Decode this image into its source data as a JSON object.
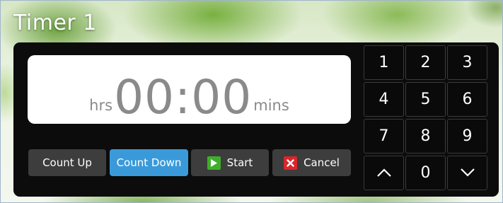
{
  "window": {
    "title": "Timer 1"
  },
  "display": {
    "time": "00:00",
    "hours_unit": "hrs",
    "minutes_unit": "mins"
  },
  "modes": [
    {
      "label": "Count Up",
      "selected": false
    },
    {
      "label": "Count Down",
      "selected": true
    }
  ],
  "actions": {
    "start_label": "Start",
    "start_icon": "play-icon",
    "cancel_label": "Cancel",
    "cancel_icon": "close-icon"
  },
  "keypad": {
    "digits": [
      "1",
      "2",
      "3",
      "4",
      "5",
      "6",
      "7",
      "8",
      "9",
      "0"
    ],
    "up_icon": "chevron-up-icon",
    "down_icon": "chevron-down-icon"
  },
  "colors": {
    "accent": "#3a9ad9",
    "start": "#3fae2a",
    "cancel": "#d9262c",
    "panel": "#0c0c0c",
    "button": "#3d3d3d"
  }
}
